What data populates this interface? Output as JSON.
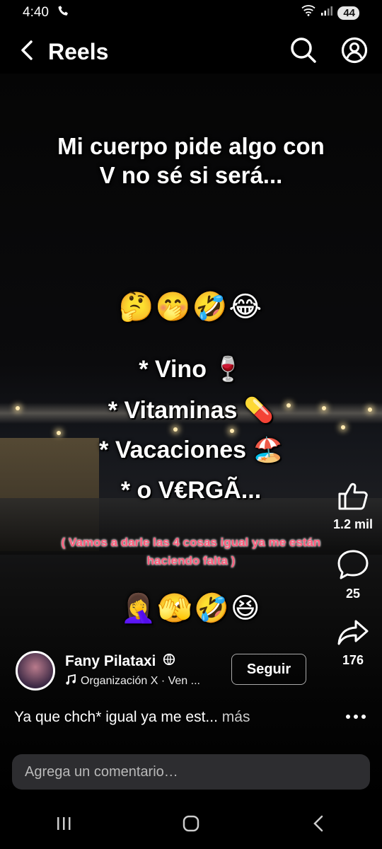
{
  "status_bar": {
    "time": "4:40",
    "battery": "44"
  },
  "header": {
    "title": "Reels"
  },
  "reel": {
    "headline": "Mi cuerpo pide algo con V no sé si será...",
    "emoji_line_1": "🤔🤭🤣😂",
    "list": [
      "* Vino 🍷",
      "* Vitaminas 💊",
      "* Vacaciones 🏖️",
      "* o V€RGÃ..."
    ],
    "note": "( Vamos a darle las 4 cosas igual ya me están haciendo falta )",
    "emoji_line_2": "🤦‍♀️🫣🤣😆"
  },
  "actions": {
    "likes": "1.2 mil",
    "comments": "25",
    "shares": "176"
  },
  "author": {
    "name": "Fany Pilataxi",
    "music": "Organización X · Ven ...",
    "follow_label": "Seguir"
  },
  "caption": {
    "text": "Ya que chch* igual ya me est...",
    "more_label": "más"
  },
  "comment_input": {
    "placeholder": "Agrega un comentario…"
  },
  "icons": [
    "back-icon",
    "search-icon",
    "profile-icon",
    "like-icon",
    "comment-icon",
    "share-icon",
    "more-icon",
    "globe-icon",
    "music-icon",
    "recents-icon",
    "home-icon",
    "nav-back-icon"
  ]
}
